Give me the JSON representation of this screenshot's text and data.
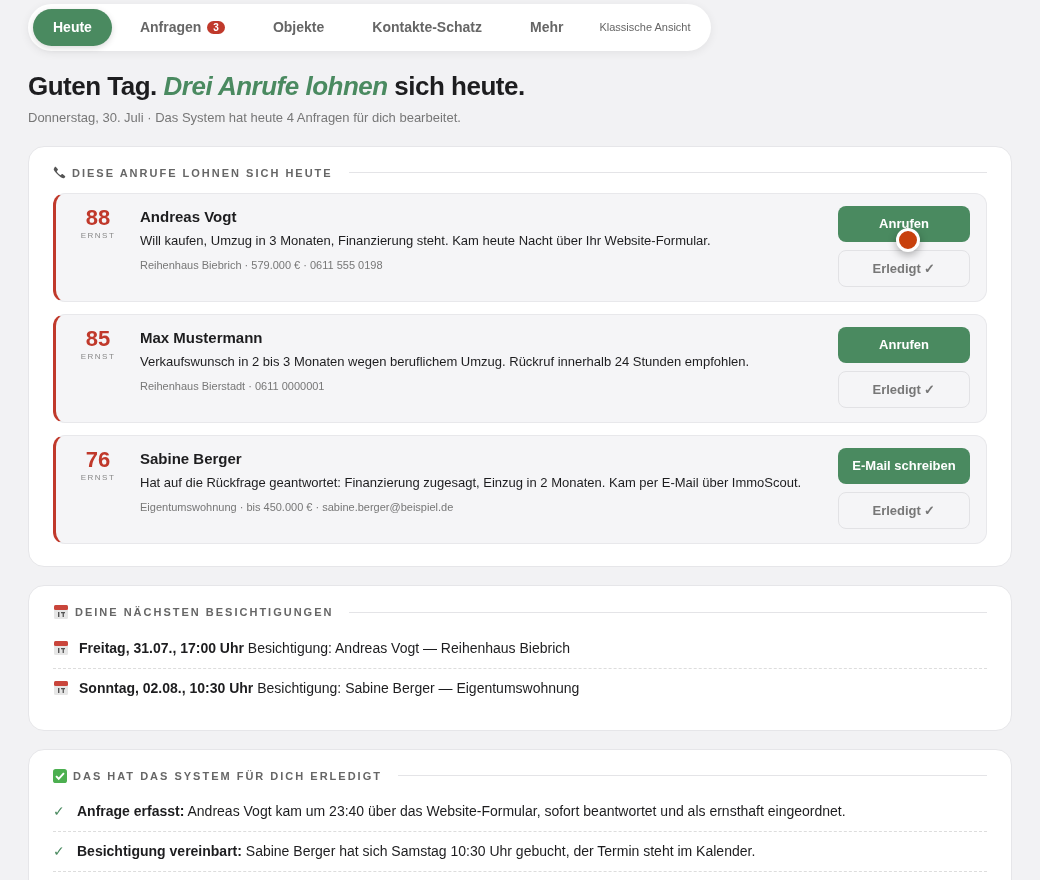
{
  "nav": {
    "tabs": [
      {
        "label": "Heute",
        "selected": true
      },
      {
        "label": "Anfragen",
        "selected": false,
        "badge": "3"
      },
      {
        "label": "Objekte",
        "selected": false
      },
      {
        "label": "Kontakte-Schatz",
        "selected": false
      },
      {
        "label": "Mehr",
        "selected": false
      }
    ],
    "link": "Klassische Ansicht"
  },
  "headline": {
    "start": "Guten Tag.",
    "highlight": "Drei Anrufe lohnen",
    "end": "sich heute."
  },
  "subtitle": "Donnerstag, 30. Juli · Das System hat heute 4 Anfragen für dich bearbeitet.",
  "calls": {
    "title": "DIESE ANRUFE LOHNEN SICH HEUTE",
    "leads": [
      {
        "score": "88",
        "score_label": "ERNST",
        "name": "Andreas Vogt",
        "text": "Will kaufen, Umzug in 3 Monaten, Finanzierung steht. Kam heute Nacht über Ihr Website-Formular.",
        "meta": "Reihenhaus Biebrich · 579.000 € · 0611 555 0198",
        "action": "Anrufen",
        "done": "Erledigt ✓",
        "pointer": true
      },
      {
        "score": "85",
        "score_label": "ERNST",
        "name": "Max Mustermann",
        "text": "Verkaufswunsch in 2 bis 3 Monaten wegen beruflichem Umzug. Rückruf innerhalb 24 Stunden empfohlen.",
        "meta": "Reihenhaus Bierstadt · 0611 0000001",
        "action": "Anrufen",
        "done": "Erledigt ✓",
        "pointer": false
      },
      {
        "score": "76",
        "score_label": "ERNST",
        "name": "Sabine Berger",
        "text": "Hat auf die Rückfrage geantwortet: Finanzierung zugesagt, Einzug in 2 Monaten. Kam per E-Mail über ImmoScout.",
        "meta": "Eigentumswohnung · bis 450.000 € · sabine.berger@beispiel.de",
        "action": "E-Mail schreiben",
        "done": "Erledigt ✓",
        "pointer": false
      }
    ]
  },
  "viewings": {
    "title": "DEINE NÄCHSTEN BESICHTIGUNGEN",
    "items": [
      {
        "when": "Freitag, 31.07., 17:00 Uhr",
        "text": "Besichtigung: Andreas Vogt — Reihenhaus Biebrich"
      },
      {
        "when": "Sonntag, 02.08., 10:30 Uhr",
        "text": "Besichtigung: Sabine Berger — Eigentumswohnung"
      }
    ]
  },
  "done": {
    "title": "DAS HAT DAS SYSTEM FÜR DICH ERLEDIGT",
    "items": [
      {
        "mark": "✓",
        "text": "**Anfrage erfasst:** Andreas Vogt kam um 23:40 über das Website-Formular, sofort beantwortet und als ernsthaft eingeordnet."
      },
      {
        "mark": "✓",
        "text": "**Besichtigung vereinbart:** Sabine Berger hat sich Samstag 10:30 Uhr gebucht, der Termin steht im Kalender."
      }
    ]
  }
}
